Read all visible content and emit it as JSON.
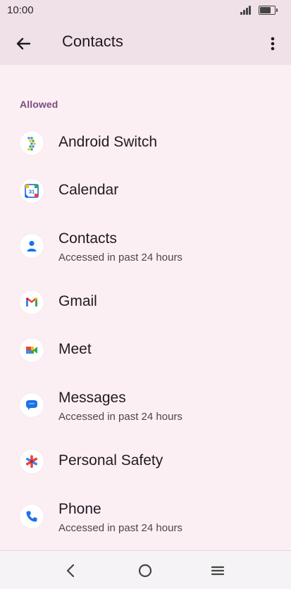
{
  "status_bar": {
    "time": "10:00"
  },
  "app_bar": {
    "title": "Contacts"
  },
  "section": {
    "header": "Allowed"
  },
  "apps": [
    {
      "name": "Android Switch",
      "subtitle": "",
      "icon": "android-switch-icon"
    },
    {
      "name": "Calendar",
      "subtitle": "",
      "icon": "calendar-icon"
    },
    {
      "name": "Contacts",
      "subtitle": "Accessed in past 24 hours",
      "icon": "contacts-icon"
    },
    {
      "name": "Gmail",
      "subtitle": "",
      "icon": "gmail-icon"
    },
    {
      "name": "Meet",
      "subtitle": "",
      "icon": "meet-icon"
    },
    {
      "name": "Messages",
      "subtitle": "Accessed in past 24 hours",
      "icon": "messages-icon"
    },
    {
      "name": "Personal Safety",
      "subtitle": "",
      "icon": "personal-safety-icon"
    },
    {
      "name": "Phone",
      "subtitle": "Accessed in past 24 hours",
      "icon": "phone-icon"
    }
  ],
  "calendar_icon_day": "31",
  "colors": {
    "background": "#fbeff4",
    "app_bar": "#efe1e7",
    "section_header": "#7a4d7e"
  }
}
